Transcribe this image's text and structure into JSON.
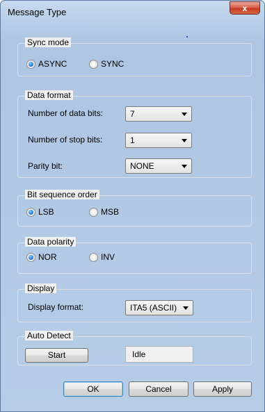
{
  "window": {
    "title": "Message Type",
    "close_label": "x"
  },
  "sync_mode": {
    "title": "Sync mode",
    "options": [
      "ASYNC",
      "SYNC"
    ],
    "selected": "ASYNC"
  },
  "data_format": {
    "title": "Data format",
    "data_bits_label": "Number of data bits:",
    "data_bits_value": "7",
    "stop_bits_label": "Number of stop bits:",
    "stop_bits_value": "1",
    "parity_label": "Parity bit:",
    "parity_value": "NONE"
  },
  "bit_order": {
    "title": "Bit sequence order",
    "options": [
      "LSB",
      "MSB"
    ],
    "selected": "LSB"
  },
  "polarity": {
    "title": "Data polarity",
    "options": [
      "NOR",
      "INV"
    ],
    "selected": "NOR"
  },
  "display": {
    "title": "Display",
    "format_label": "Display format:",
    "format_value": "ITA5 (ASCII)"
  },
  "auto_detect": {
    "title": "Auto Detect",
    "start_label": "Start",
    "status_value": "Idle"
  },
  "footer": {
    "ok_label": "OK",
    "cancel_label": "Cancel",
    "apply_label": "Apply"
  }
}
